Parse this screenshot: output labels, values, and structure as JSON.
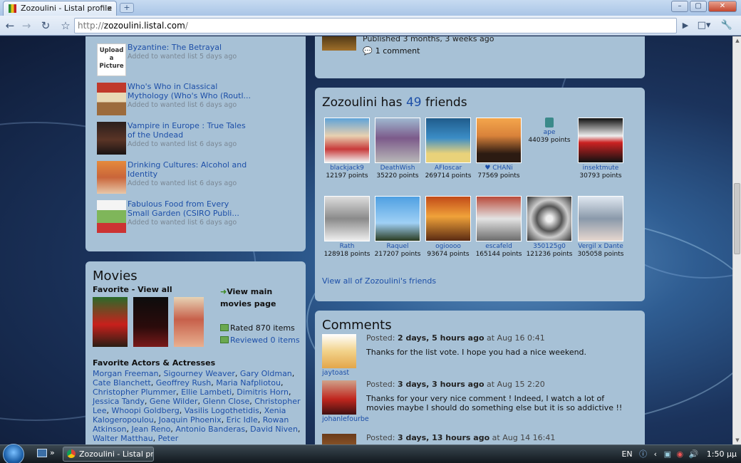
{
  "browser": {
    "tab_title": "Zozoulini - Listal profile",
    "tab_close": "x",
    "new_tab": "+",
    "url_scheme": "http://",
    "url_host": "zozoulini.listal.com",
    "url_path": "/",
    "window_buttons": [
      "–",
      "▢",
      "✕"
    ]
  },
  "wanted_list": [
    {
      "title": "Byzantine: The Betrayal",
      "meta": "Added to wanted list 5 days ago",
      "thumb": "placeholder",
      "placeholder_text": "Upload a Picture"
    },
    {
      "title": "Who's Who in Classical Mythology (Who's Who (Routl...",
      "meta": "Added to wanted list 6 days ago",
      "thumb": "book-red"
    },
    {
      "title": "Vampire in Europe : True Tales of the Undead",
      "meta": "Added to wanted list 6 days ago",
      "thumb": "book-dark"
    },
    {
      "title": "Drinking Cultures: Alcohol and Identity",
      "meta": "Added to wanted list 6 days ago",
      "thumb": "book-orange"
    },
    {
      "title": "Fabulous Food from Every Small Garden (CSIRO Publi...",
      "meta": "Added to wanted list 6 days ago",
      "thumb": "book-green"
    }
  ],
  "latest_post": {
    "published": "Published 3 months, 3 weeks ago",
    "comments": "1 comment"
  },
  "movies": {
    "title": "Movies",
    "favorite_label": "Favorite",
    "dash": " - ",
    "view_all": "View all",
    "view_main": "View main movies page",
    "rated": "Rated 870 items",
    "reviewed": "Reviewed 0 items",
    "actors_title": "Favorite Actors & Actresses",
    "actors": [
      "Morgan Freeman",
      "Sigourney Weaver",
      "Gary Oldman",
      "Cate Blanchett",
      "Geoffrey Rush",
      "Maria Nafplio­tou",
      "Christopher Plummer",
      "Ellie Lambeti",
      "Dimitris Horn",
      "Jessica Tandy",
      "Gene Wilder",
      "Glenn Close",
      "Christopher Lee",
      "Whoopi Goldberg",
      "Vasilis Logothetidis",
      "Xenia Kalogeropoulou",
      "Joaquin Phoenix",
      "Eric Idle",
      "Rowan Atkinson",
      "Jean Reno",
      "Antonio Banderas",
      "David Niven",
      "Walter Matthau",
      "Peter"
    ]
  },
  "friends": {
    "title_user": "Zozoulini has ",
    "count": "49",
    "title_suffix": " friends",
    "view_all": "View all of Zozoulini's friends",
    "list": [
      {
        "name": "blackjack9",
        "points": "12197 points",
        "pic": "tennis"
      },
      {
        "name": "DeathWish",
        "points": "35220 points",
        "pic": "street"
      },
      {
        "name": "AFIoscar",
        "points": "269714 points",
        "pic": "bluemoon"
      },
      {
        "name": "♥ CHANi",
        "points": "77569 points",
        "pic": "drawing"
      },
      {
        "name": "ape",
        "points": "44039 points",
        "pic": "none"
      },
      {
        "name": "insektmute",
        "points": "30793 points",
        "pic": "mask"
      },
      {
        "name": "Rath",
        "points": "128918 points",
        "pic": "sketch"
      },
      {
        "name": "Raquel",
        "points": "217207 points",
        "pic": "sky"
      },
      {
        "name": "ogioooo",
        "points": "93674 points",
        "pic": "fire"
      },
      {
        "name": "escafeld",
        "points": "165144 points",
        "pic": "robot"
      },
      {
        "name": "350125g0",
        "points": "121236 points",
        "pic": "stairs"
      },
      {
        "name": "Vergil x Dante",
        "points": "305058 points",
        "pic": "anime"
      }
    ]
  },
  "comments": {
    "title": "Comments",
    "posted_label": "Posted: ",
    "at_label": " at ",
    "items": [
      {
        "user": "jaytoast",
        "ago": "2 days, 5 hours ago",
        "date": "Aug 16 0:41",
        "text": "Thanks for the list vote. I hope you had a nice weekend.",
        "avatar": "toast"
      },
      {
        "user": "johanlefourbe",
        "ago": "3 days, 3 hours ago",
        "date": "Aug 15 2:20",
        "text": "Thanks for your very nice comment ! Indeed, I watch a lot of movies maybe I should do something else but it is so addictive !!",
        "avatar": "red"
      },
      {
        "user": "",
        "ago": "3 days, 13 hours ago",
        "date": "Aug 14 16:41",
        "text": "",
        "avatar": "brown"
      }
    ]
  },
  "taskbar": {
    "window_button": "Zozoulini - Listal pr...",
    "chevron": "»",
    "lang": "EN",
    "clock": "1:50 μμ"
  },
  "colors": {
    "panel": "#a7c1d6",
    "link": "#1d4fa8"
  }
}
